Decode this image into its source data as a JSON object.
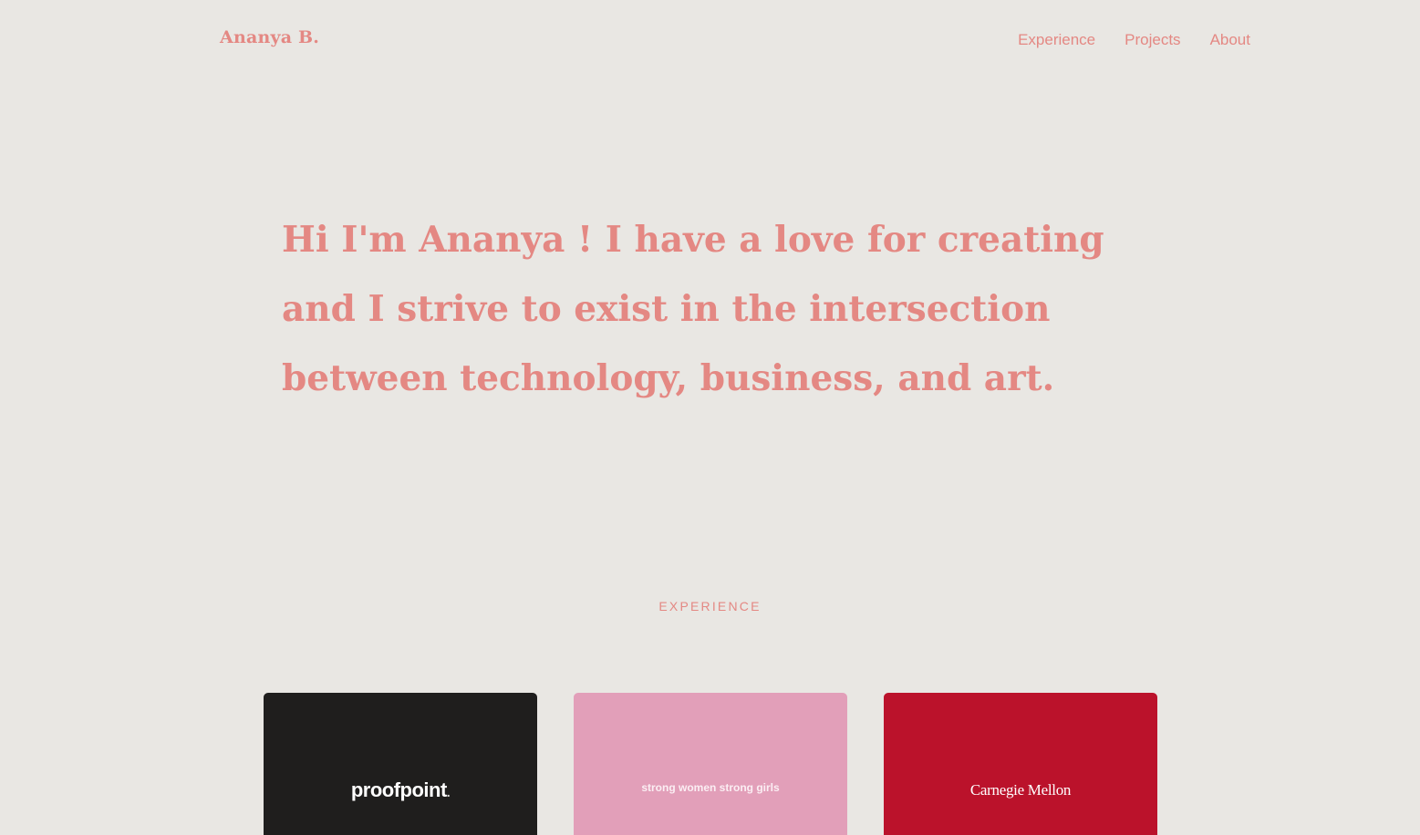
{
  "header": {
    "logo": "Ananya B.",
    "nav": [
      {
        "label": "Experience"
      },
      {
        "label": "Projects"
      },
      {
        "label": "About"
      }
    ]
  },
  "hero": {
    "intro": "Hi I'm Ananya ! I have a love for creating and I strive to exist in the intersection between technology, business, and art."
  },
  "experience": {
    "section_label": "EXPERIENCE",
    "cards": [
      {
        "logo_text": "proofpoint",
        "logo_suffix": ".",
        "background": "#1f1e1d"
      },
      {
        "logo_text": "strong women strong girls",
        "background": "#e29fb9"
      },
      {
        "logo_text": "Carnegie Mellon",
        "background": "#bb122b"
      }
    ]
  },
  "colors": {
    "background": "#e9e7e3",
    "accent": "#e48883"
  }
}
